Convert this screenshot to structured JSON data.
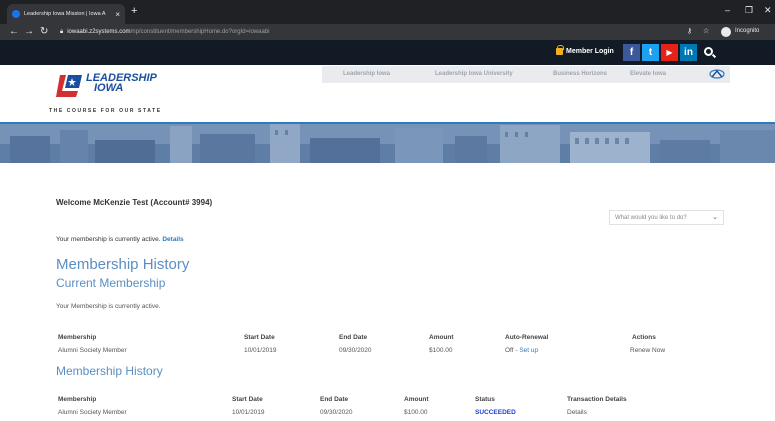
{
  "browser": {
    "tab_title": "Leadership Iowa Mission | Iowa A",
    "tab_close": "×",
    "new_tab": "+",
    "win_min": "–",
    "win_max": "❐",
    "win_close": "✕",
    "url_host": "iowaabi.z2systems.com",
    "url_path": "/np/constituent/membershipHome.do?orgId=iowaabi",
    "incognito_label": "Incognito",
    "key_icon": "key-icon",
    "star_icon": "star-icon"
  },
  "site_top": {
    "member_login": "Member Login",
    "social": [
      {
        "name": "facebook",
        "glyph": "f",
        "color": "#3b5998"
      },
      {
        "name": "twitter",
        "glyph": "t",
        "color": "#1da1f2"
      },
      {
        "name": "youtube",
        "glyph": "▶",
        "color": "#e62117"
      },
      {
        "name": "linkedin",
        "glyph": "in",
        "color": "#0077b5"
      }
    ]
  },
  "header": {
    "logo_line1": "LEADERSHIP",
    "logo_line2": "IOWA",
    "tagline": "THE COURSE FOR OUR STATE",
    "nav": [
      "Leadership Iowa",
      "Leadership Iowa University",
      "Business Horizons",
      "Elevate Iowa"
    ]
  },
  "main": {
    "welcome": "Welcome McKenzie Test (Account# 3994)",
    "action_placeholder": "What would you like to do?",
    "status_text": "Your membership is currently active.",
    "status_link": "Details",
    "heading_history": "Membership History",
    "heading_current": "Current Membership",
    "current_note": "Your Membership is currently active.",
    "current_table": {
      "headers": [
        "Membership",
        "Start Date",
        "End Date",
        "Amount",
        "Auto-Renewal",
        "Actions"
      ],
      "row": {
        "membership": "Alumni Society Member",
        "start": "10/01/2019",
        "end": "09/30/2020",
        "amount": "$100.00",
        "auto_renewal": "Off - ",
        "setup_link": "Set up",
        "action_link": "Renew Now"
      }
    },
    "heading_history2": "Membership History",
    "history_table": {
      "headers": [
        "Membership",
        "Start Date",
        "End Date",
        "Amount",
        "Status",
        "Transaction Details"
      ],
      "row": {
        "membership": "Alumni Society Member",
        "start": "10/01/2019",
        "end": "09/30/2020",
        "amount": "$100.00",
        "status": "SUCCEEDED",
        "details_link": "Details"
      }
    }
  },
  "colors": {
    "brand_blue": "#1c4ea0",
    "heading_blue": "#5b8ec2",
    "link_blue": "#2f7bbf",
    "top_bar": "#121a26",
    "status_green_text": "#1a3fd1"
  }
}
